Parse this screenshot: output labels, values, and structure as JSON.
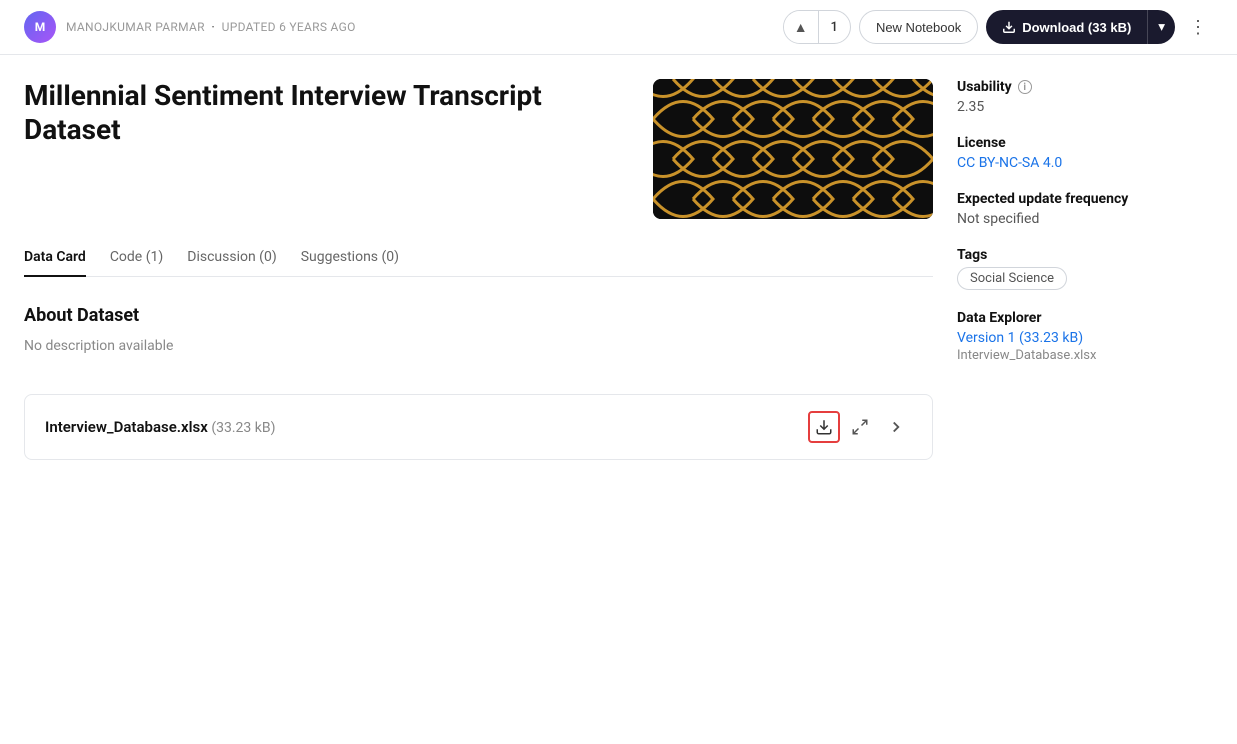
{
  "header": {
    "author": "MANOJKUMAR PARMAR",
    "updated": "UPDATED 6 YEARS AGO",
    "vote_count": "1",
    "btn_new_notebook": "New Notebook",
    "btn_download": "Download (33 kB)",
    "up_arrow": "▲",
    "chevron_down": "▾",
    "more_icon": "⋮"
  },
  "dataset": {
    "title": "Millennial Sentiment Interview Transcript Dataset"
  },
  "tabs": [
    {
      "label": "Data Card",
      "active": true
    },
    {
      "label": "Code (1)",
      "active": false
    },
    {
      "label": "Discussion (0)",
      "active": false
    },
    {
      "label": "Suggestions (0)",
      "active": false
    }
  ],
  "about": {
    "heading": "About Dataset",
    "description": "No description available"
  },
  "sidebar": {
    "usability_label": "Usability",
    "usability_value": "2.35",
    "license_label": "License",
    "license_value": "CC BY-NC-SA 4.0",
    "update_freq_label": "Expected update frequency",
    "update_freq_value": "Not specified",
    "tags_label": "Tags",
    "tag_value": "Social Science",
    "data_explorer_label": "Data Explorer",
    "data_explorer_link": "Version 1 (33.23 kB)",
    "data_explorer_sub": "Interview_Database.xlsx"
  },
  "file": {
    "name": "Interview_Database.xlsx",
    "size": "(33.23 kB)"
  }
}
